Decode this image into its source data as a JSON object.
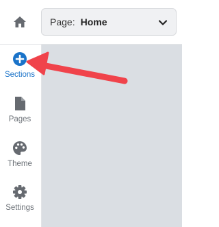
{
  "topbar": {
    "home_icon": "home-icon",
    "page_select": {
      "label": "Page:",
      "value": "Home",
      "icon": "chevron-down-icon"
    }
  },
  "sidebar": {
    "items": [
      {
        "id": "sections",
        "label": "Sections",
        "icon": "plus-circle-icon",
        "active": true
      },
      {
        "id": "pages",
        "label": "Pages",
        "icon": "page-icon",
        "active": false
      },
      {
        "id": "theme",
        "label": "Theme",
        "icon": "palette-icon",
        "active": false
      },
      {
        "id": "settings",
        "label": "Settings",
        "icon": "gear-icon",
        "active": false
      }
    ]
  },
  "annotation": {
    "icon": "red-arrow-icon",
    "color": "#f0434b"
  },
  "colors": {
    "accent": "#1a73c9",
    "canvas": "#dadee3",
    "icon_gray": "#666a70"
  }
}
